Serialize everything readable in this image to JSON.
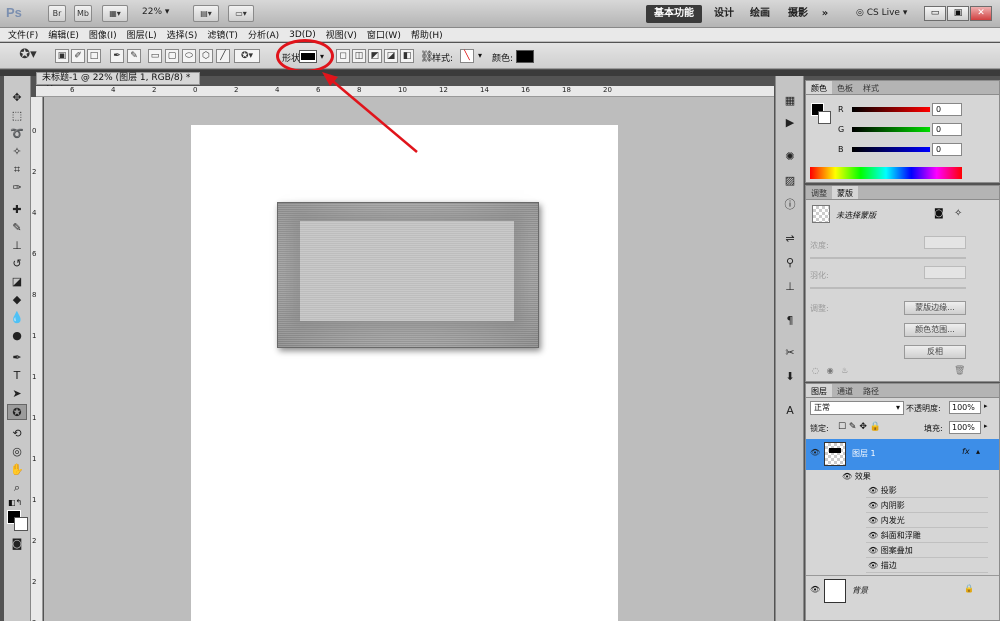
{
  "app": {
    "logo": "Ps",
    "bridge": "Br",
    "minibridge": "Mb",
    "zoom": "22%",
    "workspaces": {
      "active": "基本功能",
      "design": "设计",
      "paint": "绘画",
      "photo": "摄影",
      "more": "»"
    },
    "cslive": "CS Live",
    "win": {
      "min": "▭",
      "restore": "▣",
      "close": "✕"
    }
  },
  "menu": [
    "文件(F)",
    "编辑(E)",
    "图像(I)",
    "图层(L)",
    "选择(S)",
    "滤镜(T)",
    "分析(A)",
    "3D(D)",
    "视图(V)",
    "窗口(W)",
    "帮助(H)"
  ],
  "options": {
    "shape_label": "形状:",
    "style_label": "样式:",
    "color_label": "颜色:",
    "color_value": "#000000",
    "highlight_color": "#e0141b"
  },
  "document": {
    "tab_title": "未标题-1 @ 22% (图层 1, RGB/8) *",
    "ruler_top": [
      "6",
      "4",
      "2",
      "0",
      "2",
      "4",
      "6",
      "8",
      "10",
      "12",
      "14",
      "16",
      "18",
      "20"
    ],
    "ruler_left": [
      "0",
      "2",
      "4",
      "6",
      "8",
      "1",
      "1",
      "1",
      "1",
      "1",
      "2",
      "2",
      "2"
    ]
  },
  "color_panel": {
    "tabs": [
      "颜色",
      "色板",
      "样式"
    ],
    "rows": [
      {
        "label": "R",
        "value": "0"
      },
      {
        "label": "G",
        "value": "0"
      },
      {
        "label": "B",
        "value": "0"
      }
    ]
  },
  "masks_panel": {
    "tabs": [
      "调整",
      "蒙版"
    ],
    "title": "未选择蒙版",
    "density_label": "浓度:",
    "feather_label": "羽化:",
    "refine_label": "调整:",
    "buttons": [
      "蒙版边缘...",
      "颜色范围...",
      "反相"
    ]
  },
  "layers_panel": {
    "tabs": [
      "图层",
      "通道",
      "路径"
    ],
    "blend_mode": "正常",
    "opacity_label": "不透明度:",
    "opacity_value": "100%",
    "lock_label": "锁定:",
    "fill_label": "填充:",
    "fill_value": "100%",
    "layers": [
      {
        "name": "图层 1",
        "fx": "fx",
        "effects_label": "效果",
        "effects": [
          "投影",
          "内阴影",
          "内发光",
          "斜面和浮雕",
          "图案叠加",
          "描边"
        ]
      },
      {
        "name": "背景"
      }
    ]
  }
}
